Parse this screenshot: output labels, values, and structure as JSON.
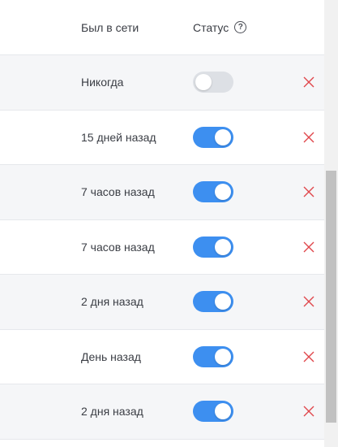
{
  "table": {
    "header": {
      "online_label": "Был в сети",
      "status_label": "Статус",
      "help_glyph": "?"
    },
    "rows": [
      {
        "last_seen": "Никогда",
        "status_on": false
      },
      {
        "last_seen": "15 дней назад",
        "status_on": true
      },
      {
        "last_seen": "7 часов назад",
        "status_on": true
      },
      {
        "last_seen": "7 часов назад",
        "status_on": true
      },
      {
        "last_seen": "2 дня назад",
        "status_on": true
      },
      {
        "last_seen": "День назад",
        "status_on": true
      },
      {
        "last_seen": "2 дня назад",
        "status_on": true
      }
    ]
  },
  "colors": {
    "accent": "#3d8ff0",
    "delete": "#e0474c",
    "toggle_off": "#dde0e5",
    "row_alt": "#f5f6f8"
  },
  "icons": {
    "help": "question-circle-icon",
    "delete": "close-icon"
  }
}
